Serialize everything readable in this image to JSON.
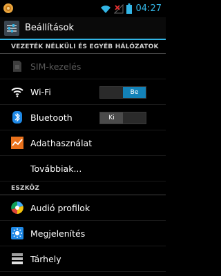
{
  "status_bar": {
    "time": "04:27",
    "icons": [
      "notification-icon",
      "wifi-icon",
      "no-signal-icon",
      "battery-icon"
    ]
  },
  "action_bar": {
    "title": "Beállítások",
    "icon": "settings-sliders-icon"
  },
  "sections": {
    "wireless": "VEZETÉK NÉLKÜLI ÉS EGYÉB HÁLÓZATOK",
    "device": "ESZKÖZ"
  },
  "items": {
    "sim": {
      "label": "SIM-kezelés",
      "icon": "sim-icon",
      "enabled": false
    },
    "wifi": {
      "label": "Wi-Fi",
      "icon": "wifi-icon",
      "toggle": "Be",
      "toggle_on": true
    },
    "bluetooth": {
      "label": "Bluetooth",
      "icon": "bluetooth-icon",
      "toggle": "Ki",
      "toggle_on": false
    },
    "data": {
      "label": "Adathasználat",
      "icon": "data-usage-icon"
    },
    "more": {
      "label": "Továbbiak..."
    },
    "audio": {
      "label": "Audió profilok",
      "icon": "audio-profiles-icon"
    },
    "display": {
      "label": "Megjelenítés",
      "icon": "display-icon"
    },
    "storage": {
      "label": "Tárhely",
      "icon": "storage-icon"
    }
  },
  "colors": {
    "accent": "#33b5e5",
    "toggle_on": "#1382b8"
  }
}
